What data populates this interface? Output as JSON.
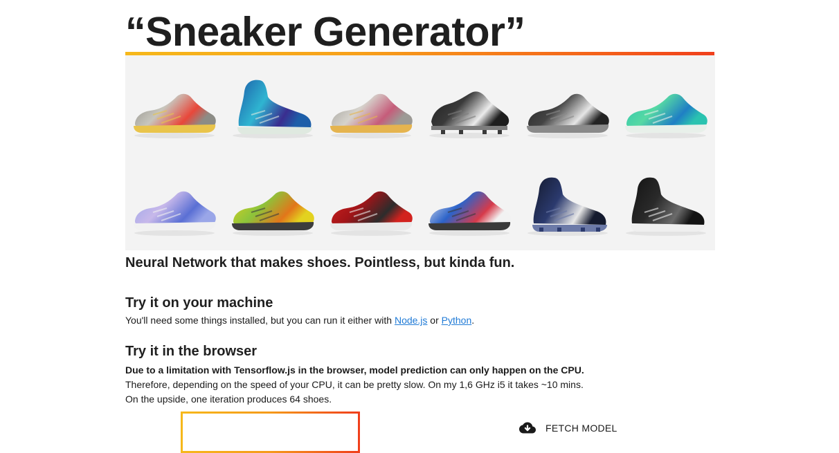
{
  "header": {
    "title": "“Sneaker Generator”"
  },
  "gallery": {
    "shoes": [
      {
        "name": "grey-multicolor-runner",
        "colors": [
          "#8c8c86",
          "#c8c6bd",
          "#e8473a",
          "#e9c44b"
        ]
      },
      {
        "name": "blue-high-top",
        "colors": [
          "#1d5fa9",
          "#2fb5d1",
          "#3a2d8f",
          "#dfe9e0"
        ]
      },
      {
        "name": "grey-retro-runner",
        "colors": [
          "#9c9a95",
          "#d6d3cc",
          "#c65c7a",
          "#e5b44f"
        ]
      },
      {
        "name": "black-cleat",
        "colors": [
          "#1e1e1e",
          "#3a3a3a",
          "#ececec",
          "#7d7d7d"
        ]
      },
      {
        "name": "black-knit-runner",
        "colors": [
          "#232323",
          "#444444",
          "#e6e6e6",
          "#8a8a8a"
        ]
      },
      {
        "name": "teal-runner",
        "colors": [
          "#2ac3b0",
          "#56d9a4",
          "#1f7fc4",
          "#e8f0ea"
        ]
      },
      {
        "name": "lavender-low",
        "colors": [
          "#9aa6e8",
          "#c7b8ea",
          "#5a6fd4",
          "#f1f1f1"
        ]
      },
      {
        "name": "yellow-camo-runner",
        "colors": [
          "#e3d21f",
          "#8cc43b",
          "#e2761a",
          "#3d3d3d"
        ]
      },
      {
        "name": "red-runner",
        "colors": [
          "#d2221e",
          "#a11418",
          "#2c2c2c",
          "#e9e9e9"
        ]
      },
      {
        "name": "white-blue-red-runner",
        "colors": [
          "#f2f2f2",
          "#2c63c9",
          "#d73a4a",
          "#3a3a3a"
        ]
      },
      {
        "name": "navy-high-cleat",
        "colors": [
          "#141a2e",
          "#2b3a6e",
          "#e8e8e8",
          "#6c7aa8"
        ]
      },
      {
        "name": "black-high-top",
        "colors": [
          "#131313",
          "#2a2a2a",
          "#6a6a6a",
          "#efefef"
        ]
      }
    ]
  },
  "tagline": "Neural Network that makes shoes. Pointless, but kinda fun.",
  "machine": {
    "heading": "Try it on your machine",
    "text_before": "You'll need some things installed, but you can run it either with ",
    "link_node": "Node.js",
    "text_middle": " or ",
    "link_python": "Python",
    "text_after": "."
  },
  "browser": {
    "heading": "Try it in the browser",
    "warning": "Due to a limitation with Tensorflow.js in the browser, model prediction can only happen on the CPU.",
    "line1": "Therefore, depending on the speed of your CPU, it can be pretty slow. On my 1,6 GHz i5 it takes ~10 mins.",
    "line2": "On the upside, one iteration produces 64 shoes."
  },
  "actions": {
    "fetch_label": "FETCH MODEL",
    "fetch_icon": "cloud-download-icon"
  },
  "colors": {
    "accent_start": "#f6b81b",
    "accent_end": "#f03f1c",
    "link": "#1f7ad6",
    "text": "#1a1a1a"
  }
}
